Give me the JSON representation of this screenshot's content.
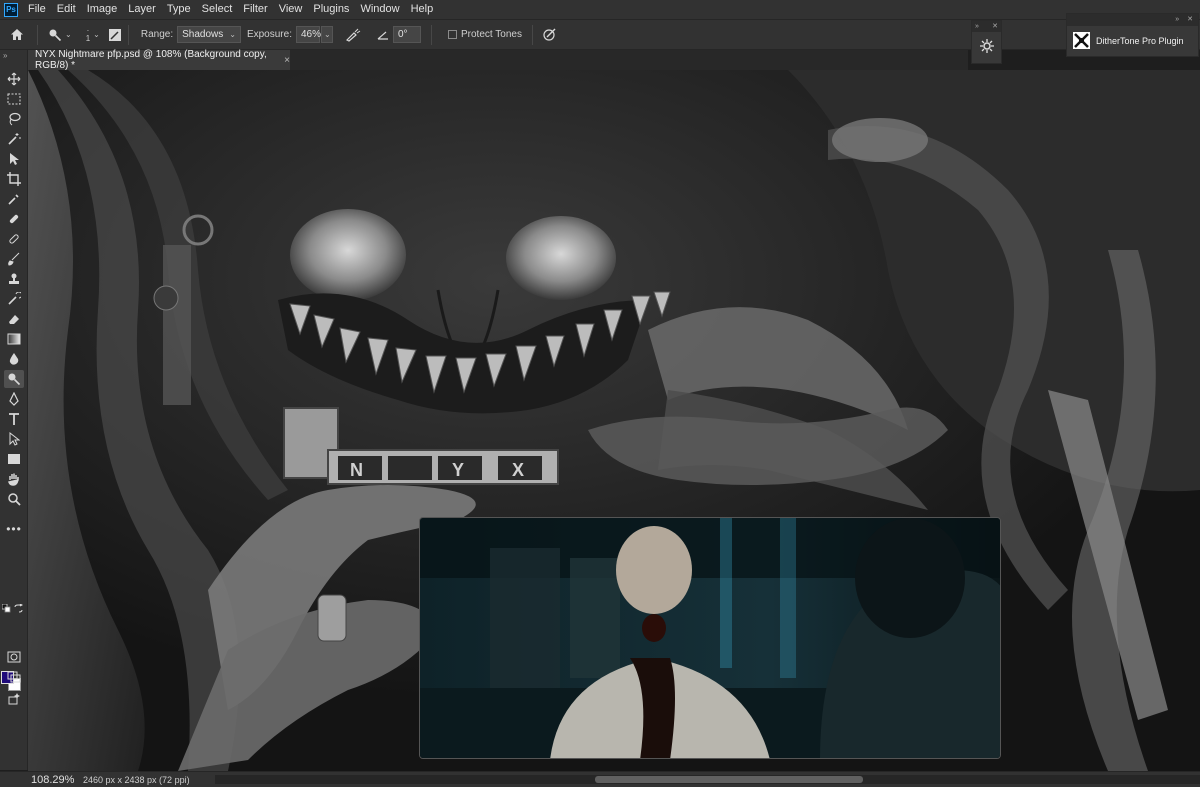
{
  "app": {
    "logo_text": "Ps",
    "menu": [
      "File",
      "Edit",
      "Image",
      "Layer",
      "Type",
      "Select",
      "Filter",
      "View",
      "Plugins",
      "Window",
      "Help"
    ]
  },
  "options": {
    "brush_size": "1",
    "range_label": "Range:",
    "range_value": "Shadows",
    "exposure_label": "Exposure:",
    "exposure_value": "46%",
    "angle_value": "0°",
    "protect_tones_label": "Protect Tones"
  },
  "document": {
    "tab_title": "NYX Nightmare pfp.psd @ 108% (Background copy, RGB/8) *",
    "tab_close": "×"
  },
  "artwork": {
    "nameplate_letters": [
      "N",
      "Y",
      "X"
    ]
  },
  "status": {
    "zoom": "108.29%",
    "doc_info": "2460 px x 2438 px (72 ppi)",
    "arrow": "›"
  },
  "plugin": {
    "name": "DitherTone Pro Plugin"
  },
  "colors": {
    "foreground": "#1f0a7a",
    "background": "#ffffff",
    "accent": "#31a8ff"
  },
  "icons": {
    "home": "home-icon",
    "dodge": "dodge-tool-icon",
    "airbrush": "airbrush-icon",
    "angle": "angle-icon",
    "pressure": "pressure-icon",
    "plugin": "plugin-logo-icon"
  }
}
